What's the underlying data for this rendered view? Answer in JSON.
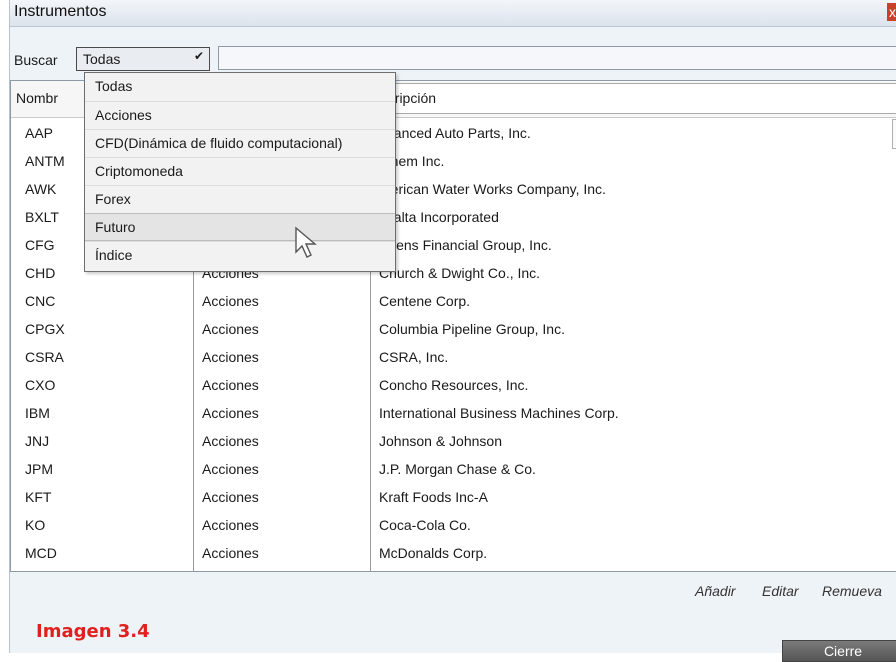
{
  "window": {
    "title": "Instrumentos",
    "close_glyph": "x"
  },
  "search": {
    "label": "Buscar",
    "selected": "Todas",
    "input_value": ""
  },
  "dropdown": {
    "options": [
      "Todas",
      "Acciones",
      "CFD(Dinámica de fluido computacional)",
      "Criptomoneda",
      "Forex",
      "Futuro",
      "Índice"
    ],
    "hovered": "Futuro"
  },
  "table": {
    "headers": [
      "Nombre",
      "",
      "Descripción"
    ],
    "header_visible": [
      "Nombr",
      "",
      "escripción"
    ],
    "rows": [
      {
        "symbol": "AAP",
        "type": "",
        "description": "dvanced Auto Parts, Inc."
      },
      {
        "symbol": "ANTM",
        "type": "",
        "description": "nthem Inc."
      },
      {
        "symbol": "AWK",
        "type": "",
        "description": "merican Water Works Company, Inc."
      },
      {
        "symbol": "BXLT",
        "type": "",
        "description": "axalta Incorporated"
      },
      {
        "symbol": "CFG",
        "type": "",
        "description": "itizens Financial Group, Inc."
      },
      {
        "symbol": "CHD",
        "type": "Acciones",
        "description": "Church & Dwight Co., Inc."
      },
      {
        "symbol": "CNC",
        "type": "Acciones",
        "description": "Centene Corp."
      },
      {
        "symbol": "CPGX",
        "type": "Acciones",
        "description": "Columbia Pipeline Group, Inc."
      },
      {
        "symbol": "CSRA",
        "type": "Acciones",
        "description": "CSRA, Inc."
      },
      {
        "symbol": "CXO",
        "type": "Acciones",
        "description": "Concho Resources, Inc."
      },
      {
        "symbol": "IBM",
        "type": "Acciones",
        "description": "International Business Machines Corp."
      },
      {
        "symbol": "JNJ",
        "type": "Acciones",
        "description": "Johnson & Johnson"
      },
      {
        "symbol": "JPM",
        "type": "Acciones",
        "description": "J.P. Morgan Chase & Co."
      },
      {
        "symbol": "KFT",
        "type": "Acciones",
        "description": "Kraft Foods Inc-A"
      },
      {
        "symbol": "KO",
        "type": "Acciones",
        "description": "Coca-Cola Co."
      },
      {
        "symbol": "MCD",
        "type": "Acciones",
        "description": "McDonalds Corp."
      }
    ]
  },
  "actions": {
    "add": "Añadir",
    "edit": "Editar",
    "remove": "Remueva"
  },
  "caption": "Imagen 3.4",
  "close_button": "Cierre",
  "icons": {
    "dropdown_chevron": "chevron-down-icon",
    "cursor": "mouse-pointer-icon",
    "scroll_up": "scroll-up-icon",
    "scroll_down": "scroll-down-icon"
  },
  "colors": {
    "caption": "#e0201e",
    "close_x_bg": "#c8412b",
    "window_bg": "#eef3f8"
  }
}
